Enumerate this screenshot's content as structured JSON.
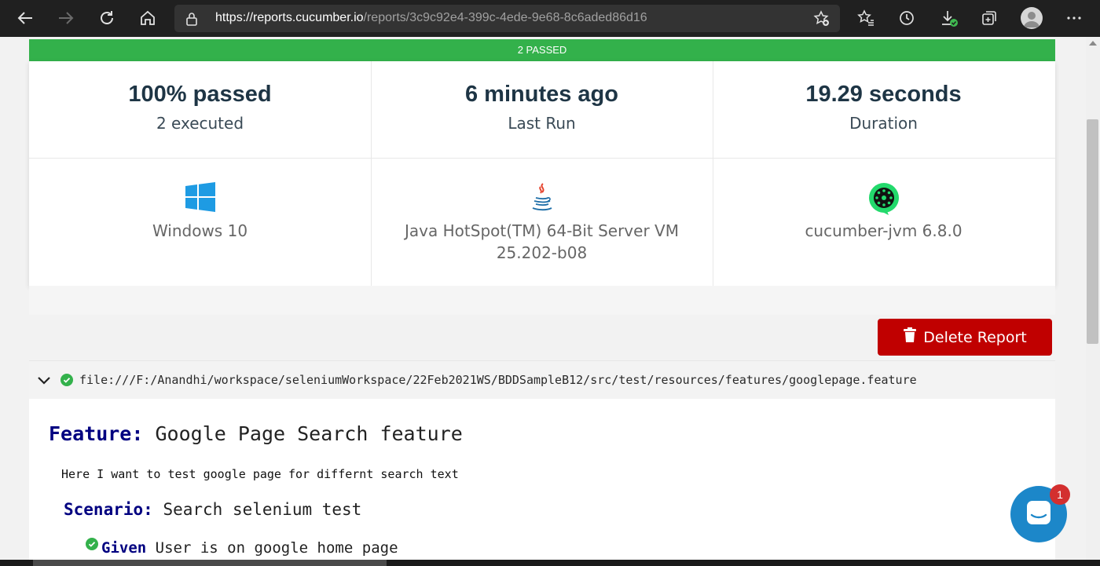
{
  "browser": {
    "url_host": "https://reports.cucumber.io",
    "url_path": "/reports/3c9c92e4-399c-4ede-9e68-8c6aded86d16",
    "icons": [
      "back-icon",
      "forward-icon",
      "reload-icon",
      "home-icon",
      "lock-icon",
      "add-favorite-icon",
      "favorites-icon",
      "history-icon",
      "downloads-icon",
      "collections-icon",
      "profile-avatar",
      "more-icon"
    ]
  },
  "summary": {
    "banner": "2 PASSED",
    "passed_pct": "100% passed",
    "executed": "2 executed",
    "last_run": "6 minutes ago",
    "last_run_label": "Last Run",
    "duration": "19.29 seconds",
    "duration_label": "Duration",
    "os": "Windows 10",
    "jvm_line1": "Java HotSpot(TM) 64-Bit Server VM",
    "jvm_line2": "25.202-b08",
    "tool": "cucumber-jvm 6.8.0"
  },
  "actions": {
    "delete_label": "Delete Report"
  },
  "feature": {
    "file_path": "file:///F:/Anandhi/workspace/seleniumWorkspace/22Feb2021WS/BDDSampleB12/src/test/resources/features/googlepage.feature",
    "keyword": "Feature:",
    "name": "Google Page Search feature",
    "description": "Here I want to test google page for differnt search text",
    "scenario_keyword": "Scenario:",
    "scenario_name": "Search selenium test",
    "steps": [
      {
        "keyword": "Given",
        "text": "User is on google home page",
        "status": "passed"
      }
    ]
  },
  "chat": {
    "unread_count": "1"
  },
  "colors": {
    "passed": "#33b14b",
    "delete": "#c00000",
    "keyword": "#000080",
    "chat": "#1c87c9"
  }
}
